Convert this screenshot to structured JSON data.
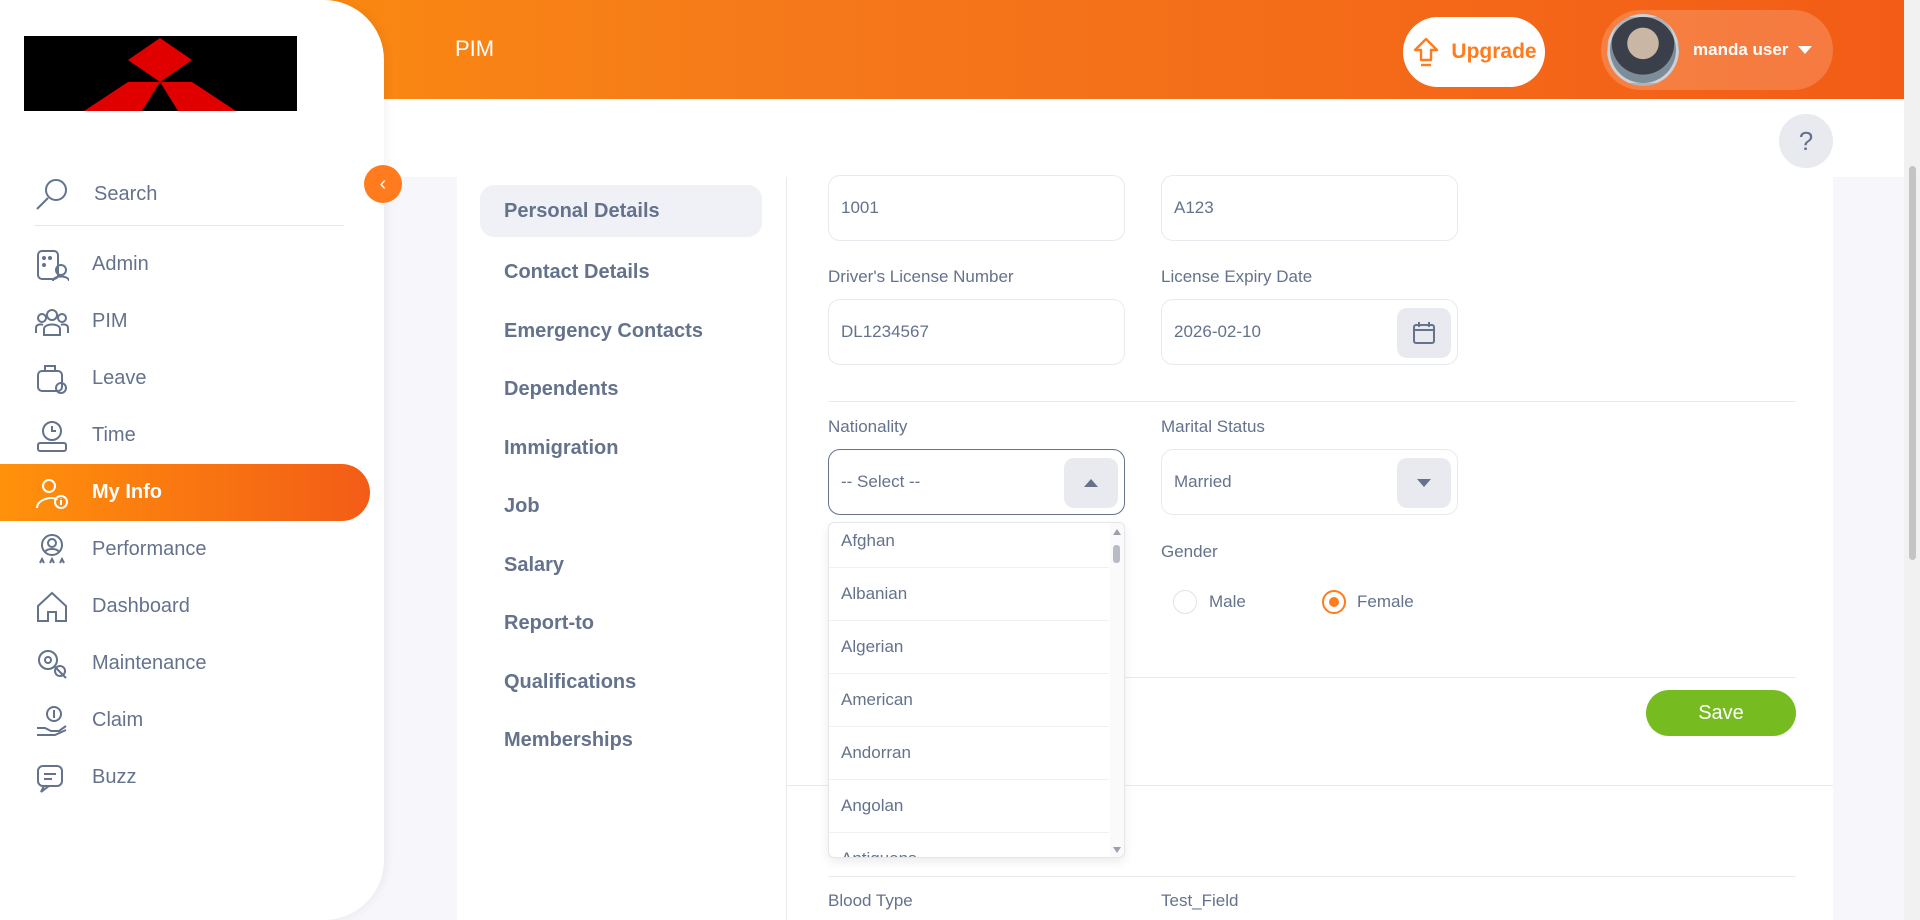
{
  "header": {
    "module_title": "PIM",
    "upgrade_label": "Upgrade",
    "user_name": "manda user",
    "help_label": "?"
  },
  "sidebar": {
    "search_label": "Search",
    "collapse_icon": "‹",
    "items": [
      {
        "label": "Admin",
        "icon": "admin-icon",
        "active": false
      },
      {
        "label": "PIM",
        "icon": "pim-icon",
        "active": false
      },
      {
        "label": "Leave",
        "icon": "leave-icon",
        "active": false
      },
      {
        "label": "Time",
        "icon": "time-icon",
        "active": false
      },
      {
        "label": "My Info",
        "icon": "myinfo-icon",
        "active": true
      },
      {
        "label": "Performance",
        "icon": "performance-icon",
        "active": false
      },
      {
        "label": "Dashboard",
        "icon": "dashboard-icon",
        "active": false
      },
      {
        "label": "Maintenance",
        "icon": "maintenance-icon",
        "active": false
      },
      {
        "label": "Claim",
        "icon": "claim-icon",
        "active": false
      },
      {
        "label": "Buzz",
        "icon": "buzz-icon",
        "active": false
      }
    ]
  },
  "tabs": [
    {
      "label": "Personal Details",
      "active": true
    },
    {
      "label": "Contact Details"
    },
    {
      "label": "Emergency Contacts"
    },
    {
      "label": "Dependents"
    },
    {
      "label": "Immigration"
    },
    {
      "label": "Job"
    },
    {
      "label": "Salary"
    },
    {
      "label": "Report-to"
    },
    {
      "label": "Qualifications"
    },
    {
      "label": "Memberships"
    }
  ],
  "form": {
    "employee_id_value": "1001",
    "other_id_value": "A123",
    "license_label": "Driver's License Number",
    "license_value": "DL1234567",
    "expiry_label": "License Expiry Date",
    "expiry_value": "2026-02-10",
    "nationality_label": "Nationality",
    "nationality_value": "-- Select --",
    "marital_label": "Marital Status",
    "marital_value": "Married",
    "gender_label": "Gender",
    "gender_options": [
      "Male",
      "Female"
    ],
    "gender_selected": "Female",
    "save_label": "Save",
    "blood_type_label": "Blood Type",
    "test_field_label": "Test_Field"
  },
  "nationality_options": [
    "Afghan",
    "Albanian",
    "Algerian",
    "American",
    "Andorran",
    "Angolan",
    "Antiguans"
  ],
  "colors": {
    "accent": "#ff7b1d",
    "save": "#76bc21",
    "text": "#64728c"
  }
}
